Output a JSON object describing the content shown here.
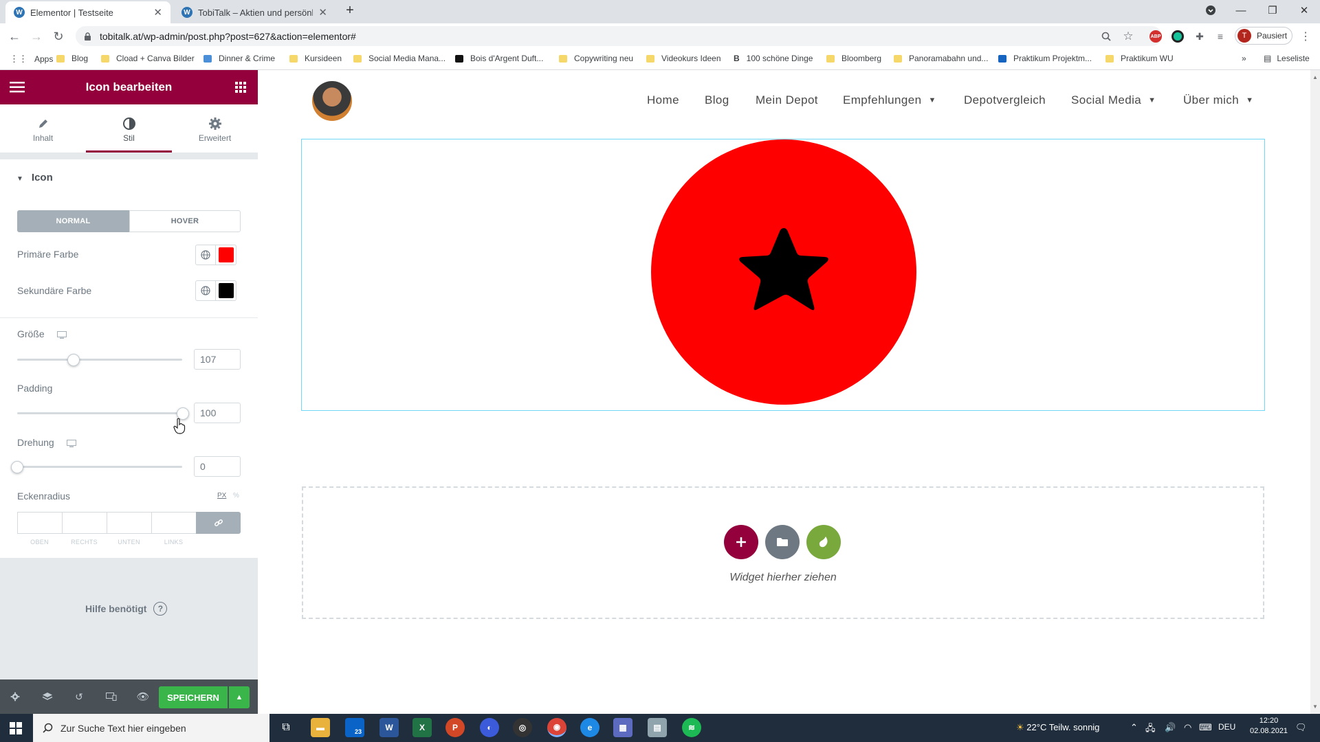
{
  "browser": {
    "tabs": [
      {
        "title": "Elementor | Testseite",
        "active": true
      },
      {
        "title": "TobiTalk – Aktien und persönliche",
        "active": false
      }
    ],
    "url": "tobitalk.at/wp-admin/post.php?post=627&action=elementor#",
    "profile_label": "Pausiert",
    "profile_initial": "T",
    "bookmarks": [
      "Apps",
      "Blog",
      "Cload + Canva Bilder",
      "Dinner & Crime",
      "Kursideen",
      "Social Media Mana...",
      "Bois d'Argent Duft...",
      "Copywriting neu",
      "Videokurs Ideen",
      "100 schöne Dinge",
      "Bloomberg",
      "Panoramabahn und...",
      "Praktikum Projektm...",
      "Praktikum WU"
    ],
    "reading_list": "Leseliste"
  },
  "panel": {
    "title": "Icon bearbeiten",
    "tabs": [
      "Inhalt",
      "Stil",
      "Erweitert"
    ],
    "section_title": "Icon",
    "state_normal": "NORMAL",
    "state_hover": "HOVER",
    "primary_color_label": "Primäre Farbe",
    "primary_color": "#ff0000",
    "secondary_color_label": "Sekundäre Farbe",
    "secondary_color": "#000000",
    "size_label": "Größe",
    "size_value": "107",
    "padding_label": "Padding",
    "padding_value": "100",
    "rotation_label": "Drehung",
    "rotation_value": "0",
    "radius_label": "Eckenradius",
    "unit_px": "PX",
    "unit_pct": "%",
    "dim_labels": [
      "OBEN",
      "RECHTS",
      "UNTEN",
      "LINKS"
    ],
    "help_text": "Hilfe benötigt",
    "save_label": "SPEICHERN"
  },
  "site": {
    "nav": [
      "Home",
      "Blog",
      "Mein Depot",
      "Empfehlungen",
      "Depotvergleich",
      "Social Media",
      "Über mich"
    ],
    "drop_text": "Widget hierher ziehen"
  },
  "taskbar": {
    "search_placeholder": "Zur Suche Text hier eingeben",
    "weather": "22°C  Teilw. sonnig",
    "lang": "DEU",
    "time": "12:20",
    "date": "02.08.2021",
    "mail_badge": "23"
  },
  "colors": {
    "brand": "#93003c",
    "save": "#39b54a",
    "icon_bg": "#ff0000",
    "selection": "#71d7f7"
  }
}
